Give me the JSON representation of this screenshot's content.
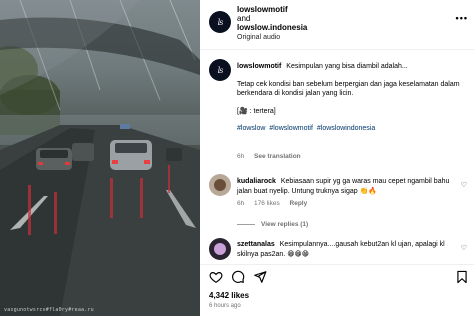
{
  "media": {
    "watermark_text": "vasgunotwsrcv#fla0ry#reaa.ru"
  },
  "header": {
    "username": "lowslowmotif",
    "and_text": "and",
    "collaborator": "lowslow.indonesia",
    "audio": "Original audio",
    "more_label": "•••"
  },
  "caption": {
    "username": "lowslowmotif",
    "first_line": "Kesimpulan yang bisa diambil adalah...",
    "body": "Tetap cek kondisi ban sebelum berpergian dan jaga keselamatan dalam berkendara di kondisi jalan yang licin.",
    "credit": "[🎥 : tertera]",
    "hashtags": [
      "#lowslow",
      "#lowslowmotif",
      "#lowslowindonesia"
    ],
    "age": "6h",
    "see_translation": "See translation"
  },
  "comments": [
    {
      "username": "kudaliarock",
      "text": "Kebiasaan supir yg ga waras mau cepet ngambil bahu jalan buat nyelip. Untung truknya sigap 👏🔥",
      "age": "6h",
      "likes": "176 likes",
      "reply": "Reply",
      "view_replies": "View replies (1)"
    },
    {
      "username": "szettanalas",
      "text": "Kesimpulannya....gausah kebut2an kl ujan, apalagi kl skilnya pas2an. 😁😁😁"
    }
  ],
  "footer": {
    "likes": "4,342 likes",
    "time_ago": "6 hours ago"
  },
  "icons": {
    "like": "heart-icon",
    "comment": "comment-icon",
    "share": "send-icon",
    "save": "bookmark-icon"
  }
}
